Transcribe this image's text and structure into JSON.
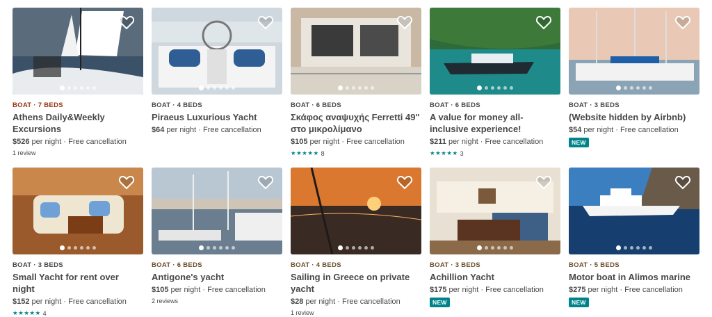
{
  "listings": [
    {
      "kicker": "BOAT · 7 BEDS",
      "kicker_color": "#993311",
      "title": "Athens Daily&Weekly Excursions",
      "price": "$526",
      "per": "per night",
      "cancel": "Free cancellation",
      "rating_stars": "",
      "rating_count": "",
      "reviews": "1 review",
      "badge": "",
      "photo": "sailboat-deck",
      "active_dot": 1
    },
    {
      "kicker": "BOAT · 4 BEDS",
      "kicker_color": "#484848",
      "title": "Piraeus Luxurious Yacht",
      "price": "$64",
      "per": "per night",
      "cancel": "Free cancellation",
      "rating_stars": "",
      "rating_count": "",
      "reviews": "",
      "badge": "",
      "photo": "yacht-cockpit",
      "active_dot": 1
    },
    {
      "kicker": "BOAT · 6 BEDS",
      "kicker_color": "#484848",
      "title": "Σκάφος αναψυχής Ferretti 49\" στο μικρολίμανο",
      "price": "$105",
      "per": "per night",
      "cancel": "Free cancellation",
      "rating_stars": "★★★★★",
      "rating_count": "8",
      "reviews": "",
      "badge": "",
      "photo": "yacht-stern",
      "active_dot": 1
    },
    {
      "kicker": "BOAT · 6 BEDS",
      "kicker_color": "#484848",
      "title": "A value for money all-inclusive experience!",
      "price": "$211",
      "per": "per night",
      "cancel": "Free cancellation",
      "rating_stars": "★★★★★",
      "rating_count": "3",
      "reviews": "",
      "badge": "",
      "photo": "motorboat-bay",
      "active_dot": 1
    },
    {
      "kicker": "BOAT · 3 BEDS",
      "kicker_color": "#484848",
      "title": "(Website hidden by Airbnb)",
      "price": "$54",
      "per": "per night",
      "cancel": "Free cancellation",
      "rating_stars": "",
      "rating_count": "",
      "reviews": "",
      "badge": "NEW",
      "photo": "marina-masts",
      "active_dot": 1
    },
    {
      "kicker": "BOAT · 3 BEDS",
      "kicker_color": "#484848",
      "title": "Small Yacht for rent over night",
      "price": "$152",
      "per": "per night",
      "cancel": "Free cancellation",
      "rating_stars": "★★★★★",
      "rating_count": "4",
      "reviews": "",
      "badge": "",
      "photo": "wood-salon",
      "active_dot": 1
    },
    {
      "kicker": "BOAT · 6 BEDS",
      "kicker_color": "#6b4f2a",
      "title": "Antigone's yacht",
      "price": "$105",
      "per": "per night",
      "cancel": "Free cancellation",
      "rating_stars": "",
      "rating_count": "",
      "reviews": "2 reviews",
      "badge": "",
      "photo": "harbor-town",
      "active_dot": 1
    },
    {
      "kicker": "BOAT · 4 BEDS",
      "kicker_color": "#6b4f2a",
      "title": "Sailing in Greece on private yacht",
      "price": "$28",
      "per": "per night",
      "cancel": "Free cancellation",
      "rating_stars": "",
      "rating_count": "",
      "reviews": "1 review",
      "badge": "",
      "photo": "sunset-sea",
      "active_dot": 1
    },
    {
      "kicker": "BOAT · 3 BEDS",
      "kicker_color": "#6b4f2a",
      "title": "Achillion Yacht",
      "price": "$175",
      "per": "per night",
      "cancel": "Free cancellation",
      "rating_stars": "",
      "rating_count": "",
      "reviews": "",
      "badge": "NEW",
      "photo": "cabin-interior",
      "active_dot": 1
    },
    {
      "kicker": "BOAT · 5 BEDS",
      "kicker_color": "#6b4f2a",
      "title": "Motor boat in Alimos marine",
      "price": "$275",
      "per": "per night",
      "cancel": "Free cancellation",
      "rating_stars": "",
      "rating_count": "",
      "reviews": "",
      "badge": "NEW",
      "photo": "white-motor-yacht",
      "active_dot": 1
    }
  ],
  "dots_per_photo": 6
}
